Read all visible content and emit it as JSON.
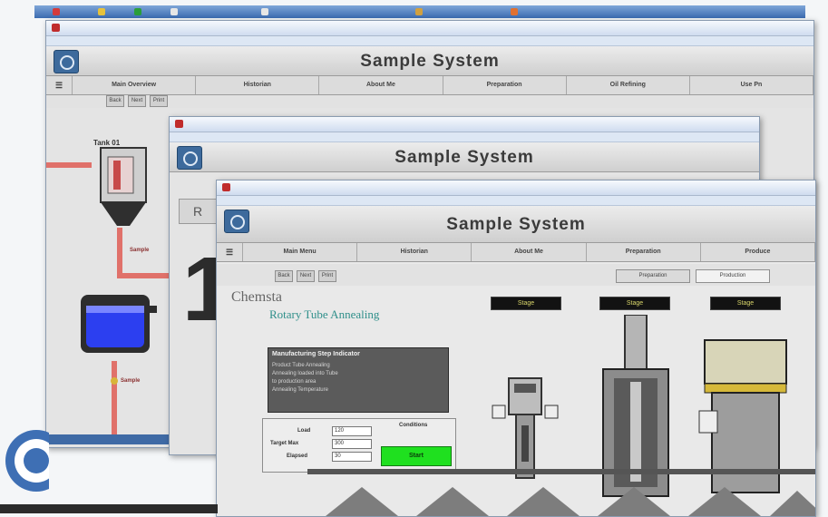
{
  "app_title": "Sample System",
  "windows": {
    "back": {
      "title": "Sample System",
      "nav": [
        "Main Overview",
        "Historian",
        "About Me",
        "Preparation",
        "Oil Refining",
        "Use Pn"
      ],
      "toolbar_buttons": [
        "Back",
        "Next",
        "Print"
      ],
      "tank_label": "Tank 01",
      "pipe_label": "Sample",
      "valve_label": "Sample"
    },
    "middle": {
      "title": "Sample System",
      "big_number": "1",
      "side_label": "R"
    },
    "front": {
      "title": "Sample System",
      "nav": [
        "Main Menu",
        "Historian",
        "About Me",
        "Preparation",
        "Produce"
      ],
      "toolbar_buttons": [
        "Back",
        "Next",
        "Print"
      ],
      "tabs": [
        "Preparation",
        "Production"
      ],
      "process_title": "Chemsta",
      "process_subtitle": "Rotary Tube Annealing",
      "machine_labels": [
        "Stage",
        "Stage",
        "Stage"
      ],
      "info_box": {
        "header": "Manufacturing Step Indicator",
        "lines": [
          "Product Tube Annealing",
          "Annealing loaded into Tube",
          "to production area",
          "Annealing Temperature"
        ]
      },
      "form": {
        "header": "Conditions",
        "rows": [
          {
            "label": "Load",
            "value": "120"
          },
          {
            "label": "Target Max",
            "value": "300"
          },
          {
            "label": "Elapsed",
            "value": "30"
          }
        ],
        "start_label": "Start"
      }
    }
  },
  "colors": {
    "taskbar": "#3b6bb0",
    "tank_blue": "#2c3ff0",
    "pipe_red": "#e0716a",
    "start_green": "#1fe01f",
    "yellow_text": "#d9d66a",
    "status_blue": "#3f6aa5"
  }
}
